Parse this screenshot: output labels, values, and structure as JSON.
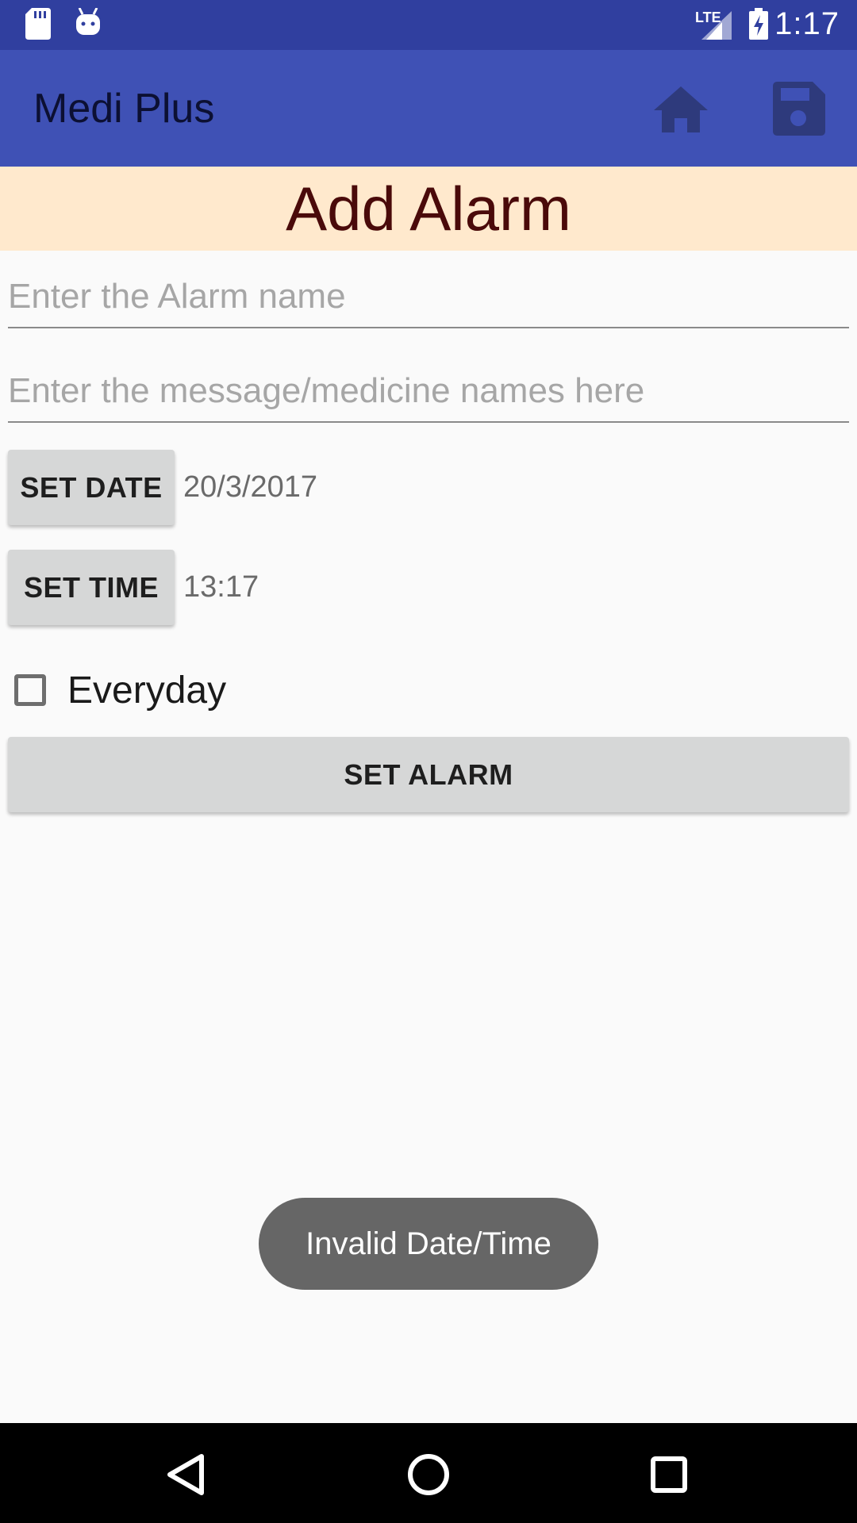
{
  "status_bar": {
    "time": "1:17",
    "network": "LTE",
    "left_icons": [
      "sd-card-icon",
      "android-debug-icon"
    ],
    "right_icons": [
      "signal-icon",
      "battery-charging-icon"
    ]
  },
  "app_bar": {
    "title": "Medi Plus",
    "actions": [
      "home-icon",
      "save-icon"
    ]
  },
  "header": {
    "title": "Add Alarm"
  },
  "form": {
    "alarm_name_placeholder": "Enter the Alarm name",
    "alarm_name_value": "",
    "message_placeholder": "Enter the message/medicine names here",
    "message_value": "",
    "set_date_label": "SET DATE",
    "date_value": "20/3/2017",
    "set_time_label": "SET TIME",
    "time_value": "13:17",
    "everyday_label": "Everyday",
    "everyday_checked": false,
    "set_alarm_label": "SET ALARM"
  },
  "toast": {
    "message": "Invalid Date/Time"
  },
  "nav_bar": {
    "buttons": [
      "back-icon",
      "home-circle-icon",
      "recents-icon"
    ]
  },
  "colors": {
    "status_bar": "#303f9f",
    "app_bar": "#3f51b5",
    "header_band": "#ffe9cd",
    "header_text": "#4a0a0a",
    "button": "#d6d7d7",
    "toast": "#666666"
  }
}
